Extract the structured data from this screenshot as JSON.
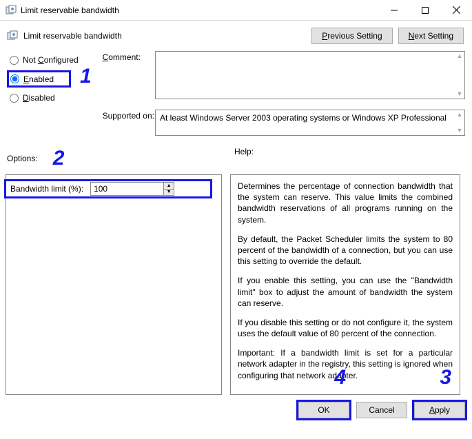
{
  "window": {
    "title": "Limit reservable bandwidth"
  },
  "subheader": {
    "label": "Limit reservable bandwidth",
    "prev_prefix": "P",
    "prev_rest": "revious Setting",
    "next_prefix": "N",
    "next_rest": "ext Setting"
  },
  "config": {
    "not_configured_prefix": "C",
    "not_configured_label": "Not ",
    "not_configured_rest": "onfigured",
    "enabled_prefix": "E",
    "enabled_rest": "nabled",
    "disabled_prefix": "D",
    "disabled_rest": "isabled",
    "comment_label_prefix": "C",
    "comment_label_rest": "omment:",
    "supported_label": "Supported on:",
    "supported_text": "At least Windows Server 2003 operating systems or Windows XP Professional"
  },
  "labels": {
    "options": "Options:",
    "help": "Help:"
  },
  "options": {
    "bandwidth_label": "Bandwidth limit (%):",
    "bandwidth_value": "100"
  },
  "help": {
    "p1": "Determines the percentage of connection bandwidth that the system can reserve. This value limits the combined bandwidth reservations of all programs running on the system.",
    "p2": "By default, the Packet Scheduler limits the system to 80 percent of the bandwidth of a connection, but you can use this setting to override the default.",
    "p3": "If you enable this setting, you can use the \"Bandwidth limit\" box to adjust the amount of bandwidth the system can reserve.",
    "p4": "If you disable this setting or do not configure it, the system uses the default value of 80 percent of the connection.",
    "p5": "Important: If a bandwidth limit is set for a particular network adapter in the registry, this setting is ignored when configuring that network adapter."
  },
  "footer": {
    "ok": "OK",
    "cancel": "Cancel",
    "apply_prefix": "A",
    "apply_rest": "pply"
  },
  "annotations": {
    "n1": "1",
    "n2": "2",
    "n3": "3",
    "n4": "4"
  }
}
